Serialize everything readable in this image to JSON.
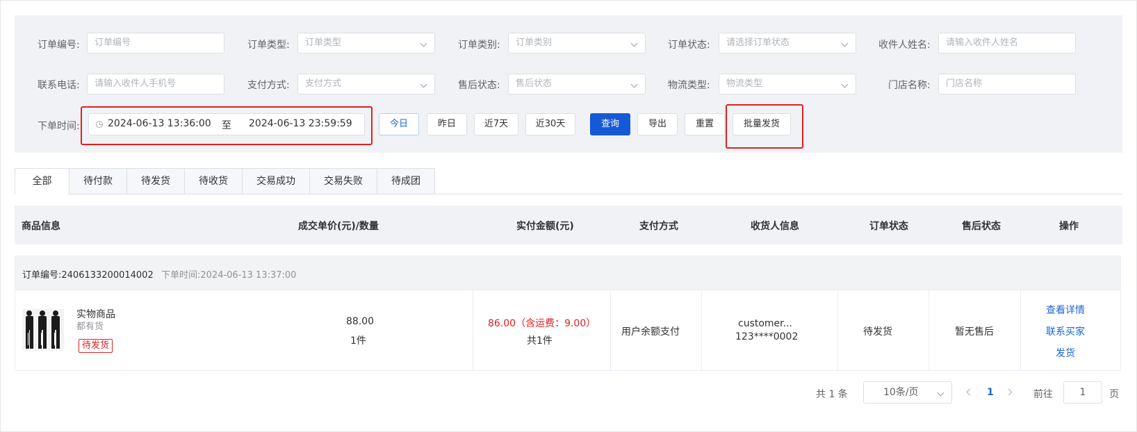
{
  "filters": {
    "order_no": {
      "label": "订单编号:",
      "placeholder": "订单编号"
    },
    "order_type": {
      "label": "订单类型:",
      "placeholder": "订单类型"
    },
    "order_category": {
      "label": "订单类别:",
      "placeholder": "订单类别"
    },
    "order_status": {
      "label": "订单状态:",
      "placeholder": "请选择订单状态"
    },
    "receiver_name": {
      "label": "收件人姓名:",
      "placeholder": "请输入收件人姓名"
    },
    "phone": {
      "label": "联系电话:",
      "placeholder": "请输入收件人手机号"
    },
    "pay_method": {
      "label": "支付方式:",
      "placeholder": "支付方式"
    },
    "after_sale": {
      "label": "售后状态:",
      "placeholder": "售后状态"
    },
    "logistics": {
      "label": "物流类型:",
      "placeholder": "物流类型"
    },
    "store": {
      "label": "门店名称:",
      "placeholder": "门店名称"
    },
    "order_time": {
      "label": "下单时间:",
      "start": "2024-06-13 13:36:00",
      "sep": "至",
      "end": "2024-06-13 23:59:59"
    }
  },
  "quick_buttons": {
    "today": "今日",
    "yesterday": "昨日",
    "last7": "近7天",
    "last30": "近30天"
  },
  "actions": {
    "query": "查询",
    "export": "导出",
    "reset": "重置",
    "batch_ship": "批量发货"
  },
  "tabs": [
    "全部",
    "待付款",
    "待发货",
    "待收货",
    "交易成功",
    "交易失败",
    "待成团"
  ],
  "table_headers": {
    "product": "商品信息",
    "price_qty": "成交单价(元)/数量",
    "paid": "实付金额(元)",
    "pay_method": "支付方式",
    "receiver": "收货人信息",
    "status": "订单状态",
    "after_sale": "售后状态",
    "ops": "操作"
  },
  "order": {
    "no_label": "订单编号:2406133200014002",
    "time_label": "下单时间:2024-06-13 13:37:00",
    "product_name": "实物商品",
    "product_sub": "都有货",
    "product_tag": "待发货",
    "unit_price": "88.00",
    "qty": "1件",
    "paid_amount": "86.00（含运费：9.00）",
    "paid_count": "共1件",
    "pay_method": "用户余额支付",
    "receiver_name": "customer...",
    "receiver_phone": "123****0002",
    "status": "待发货",
    "after_sale": "暂无售后",
    "op_detail": "查看详情",
    "op_contact": "联系买家",
    "op_ship": "发货",
    "accent_red": "#e02020",
    "link_blue": "#1a66d6"
  },
  "pagination": {
    "total": "共 1 条",
    "page_size": "10条/页",
    "current": "1",
    "goto": "前往",
    "goto_value": "1",
    "page_unit": "页"
  }
}
